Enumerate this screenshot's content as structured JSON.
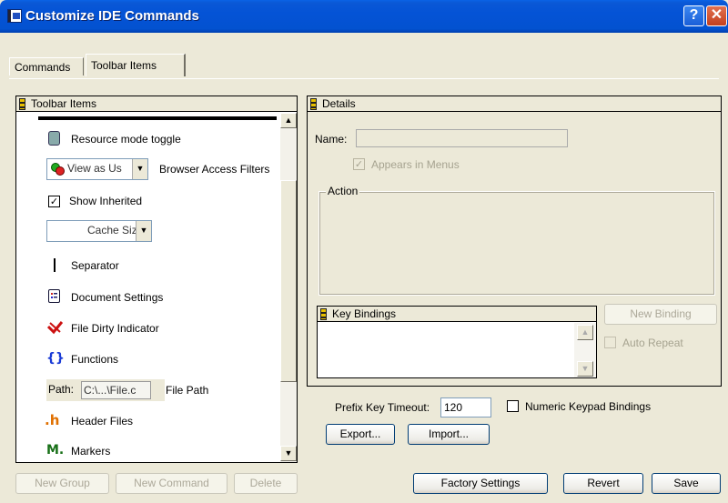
{
  "window": {
    "title": "Customize IDE Commands",
    "help_label": "?",
    "close_label": "✕"
  },
  "tabs": [
    {
      "label": "Commands"
    },
    {
      "label": "Toolbar Items"
    }
  ],
  "toolbar_items": {
    "header": "Toolbar Items",
    "items": [
      {
        "label": "Resource mode toggle",
        "icon": "resource-mode-icon"
      },
      {
        "label": "Browser Access Filters",
        "combo_value": "View as Us",
        "icon": "filter-icon"
      },
      {
        "label": "Show Inherited",
        "checked": true
      },
      {
        "label": "",
        "combo_value": "Cache Size"
      },
      {
        "label": "Separator",
        "icon": "separator-icon"
      },
      {
        "label": "Document Settings",
        "icon": "document-settings-icon"
      },
      {
        "label": "File Dirty Indicator",
        "icon": "file-dirty-icon"
      },
      {
        "label": "Functions",
        "icon": "functions-icon",
        "glyph": "{}"
      },
      {
        "label": "File Path",
        "path_label": "Path:",
        "path_value": "C:\\...\\File.c"
      },
      {
        "label": "Header Files",
        "icon": "header-files-icon",
        "glyph": ".h"
      },
      {
        "label": "Markers",
        "icon": "markers-icon",
        "glyph": "M."
      }
    ]
  },
  "details": {
    "header": "Details",
    "name_label": "Name:",
    "name_value": "",
    "appears_in_menus": "Appears in Menus",
    "action_label": "Action",
    "key_bindings_header": "Key Bindings",
    "new_binding": "New Binding",
    "auto_repeat": "Auto Repeat",
    "prefix_label": "Prefix Key Timeout:",
    "prefix_value": "120",
    "numeric_keypad": "Numeric Keypad Bindings",
    "export": "Export...",
    "import": "Import..."
  },
  "bottom_buttons": {
    "new_group": "New Group",
    "new_command": "New Command",
    "delete": "Delete",
    "factory_settings": "Factory Settings",
    "revert": "Revert",
    "save": "Save"
  },
  "colors": {
    "title_bar": "#0453d6",
    "dialog_bg": "#ece9d8"
  }
}
